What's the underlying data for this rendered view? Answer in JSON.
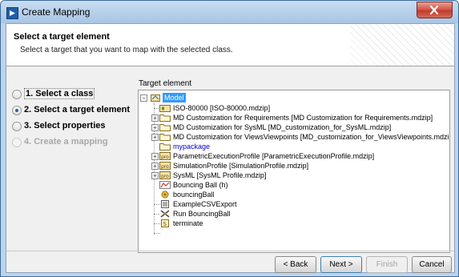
{
  "window": {
    "title": "Create Mapping"
  },
  "header": {
    "title": "Select a target element",
    "description": "Select a target that you want to map with the selected class."
  },
  "steps": [
    {
      "label": "1. Select a class",
      "state": "done"
    },
    {
      "label": "2. Select a target element",
      "state": "current"
    },
    {
      "label": "3. Select properties",
      "state": "pending"
    },
    {
      "label": "4. Create a mapping",
      "state": "disabled"
    }
  ],
  "target": {
    "group_label": "Target element",
    "tree": [
      {
        "label": "Model",
        "icon": "model-package-icon",
        "selected": true
      },
      {
        "label": "ISO-80000 [ISO-80000.mdzip]",
        "icon": "library-package-icon"
      },
      {
        "label": "MD Customization for Requirements [MD Customization for Requirements.mdzip]",
        "icon": "folder-icon"
      },
      {
        "label": "MD Customization for SysML [MD_customization_for_SysML.mdzip]",
        "icon": "folder-icon"
      },
      {
        "label": "MD Customization for ViewsViewpoints [MD_customization_for_ViewsViewpoints.mdzip]",
        "icon": "folder-icon"
      },
      {
        "label": "mypackage",
        "icon": "folder-icon"
      },
      {
        "label": "ParametricExecutionProfile [ParametricExecutionProfile.mdzip]",
        "icon": "profile-icon"
      },
      {
        "label": "SimulationProfile [SimulationProfile.mdzip]",
        "icon": "profile-icon"
      },
      {
        "label": "SysML [SysML Profile.mdzip]",
        "icon": "profile-icon"
      },
      {
        "label": "Bouncing Ball (h)",
        "icon": "diagram-icon"
      },
      {
        "label": "bouncingBall",
        "icon": "block-instance-icon"
      },
      {
        "label": "ExampleCSVExport",
        "icon": "csv-export-icon"
      },
      {
        "label": "Run BouncingBall",
        "icon": "simulation-config-icon"
      },
      {
        "label": "terminate",
        "icon": "signal-icon"
      }
    ]
  },
  "buttons": {
    "back": "< Back",
    "next": "Next >",
    "finish": "Finish",
    "cancel": "Cancel"
  },
  "colors": {
    "selection": "#3399ff",
    "link_text": "#0000cc",
    "disabled_text": "#a8a8a8"
  }
}
